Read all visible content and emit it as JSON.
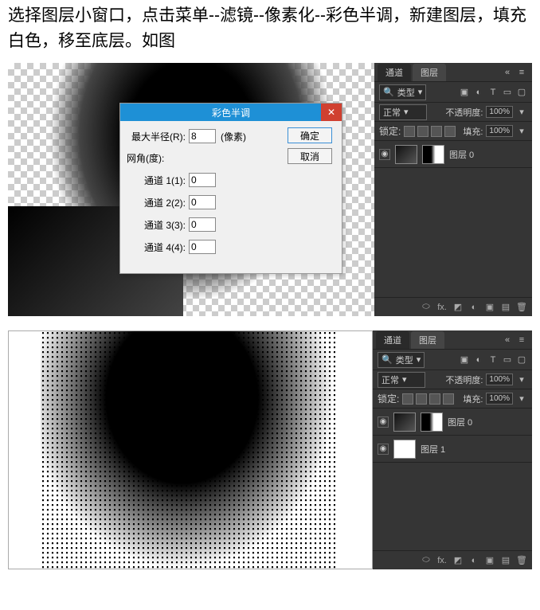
{
  "header": {
    "text": "选择图层小窗口，点击菜单--滤镜--像素化--彩色半调，新建图层，填充白色，移至底层。如图"
  },
  "dialog": {
    "title": "彩色半调",
    "close": "✕",
    "max_radius_label": "最大半径(R):",
    "max_radius_value": "8",
    "unit": "(像素)",
    "screen_angle_label": "网角(度):",
    "ch1_label": "通道 1(1):",
    "ch1_value": "0",
    "ch2_label": "通道 2(2):",
    "ch2_value": "0",
    "ch3_label": "通道 3(3):",
    "ch3_value": "0",
    "ch4_label": "通道 4(4):",
    "ch4_value": "0",
    "ok": "确定",
    "cancel": "取消"
  },
  "panel": {
    "tab_channels": "通道",
    "tab_layers": "图层",
    "filter_kind": "类型",
    "blend_mode": "正常",
    "opacity_label": "不透明度:",
    "opacity_value": "100%",
    "lock_label": "锁定:",
    "fill_label": "填充:",
    "fill_value": "100%",
    "layer0": "图层 0",
    "layer1": "图层 1",
    "fx_label": "fx."
  },
  "icons": {
    "menu": "≡",
    "collapse": "«",
    "chevron": "▾",
    "eye": "◉",
    "image": "▣",
    "adjust": "◐",
    "text": "T",
    "shape": "▭",
    "smart": "▢",
    "link": "⬭",
    "mask": "◩",
    "folder": "▣",
    "new": "▤",
    "trash": "🗑",
    "lock": "🔒"
  }
}
